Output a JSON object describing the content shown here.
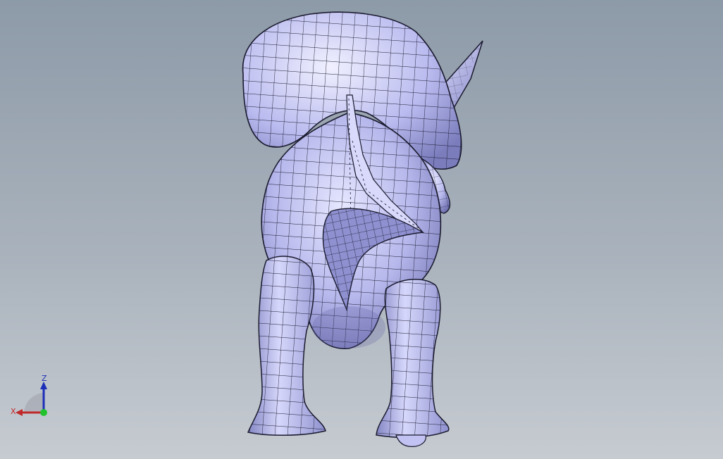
{
  "viewport": {
    "background_top": "#8d9aa8",
    "background_bottom": "#c6cbd1"
  },
  "model": {
    "surface_color": "#b7b8ec",
    "wire_color": "#1a1a2e",
    "shade_color": "#6e70b0"
  },
  "triad": {
    "x_label": "X",
    "z_label": "Z",
    "x_color": "#c0282a",
    "z_color": "#1c2fb8",
    "y_color": "#22c22e"
  }
}
